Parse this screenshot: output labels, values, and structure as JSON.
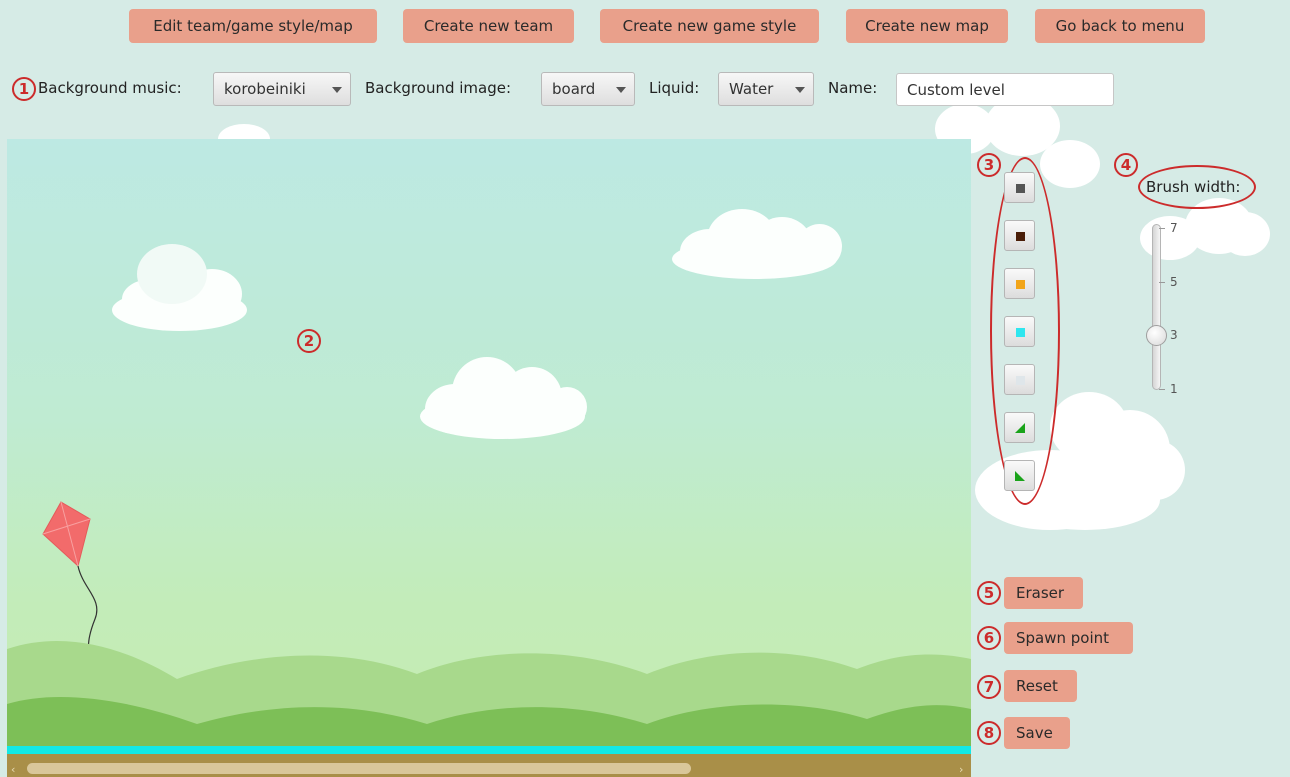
{
  "nav": {
    "edit": "Edit team/game style/map",
    "new_team": "Create new team",
    "new_style": "Create new game style",
    "new_map": "Create new map",
    "back": "Go back to menu"
  },
  "settings": {
    "music_label": "Background music:",
    "music_value": "korobeiniki",
    "image_label": "Background image:",
    "image_value": "board",
    "liquid_label": "Liquid:",
    "liquid_value": "Water",
    "name_label": "Name:",
    "name_value": "Custom level"
  },
  "brush": {
    "label": "Brush width:",
    "ticks": [
      "7",
      "5",
      "3",
      "1"
    ],
    "value": 3,
    "min": 1,
    "max": 7
  },
  "tools": [
    {
      "name": "dark-gray-block",
      "color": "#555555",
      "shape": "square"
    },
    {
      "name": "brown-block",
      "color": "#4a1d08",
      "shape": "square"
    },
    {
      "name": "orange-block",
      "color": "#f2a51a",
      "shape": "square"
    },
    {
      "name": "cyan-block",
      "color": "#2fe6ef",
      "shape": "square"
    },
    {
      "name": "ice-block",
      "color": "#dfe6ea",
      "shape": "square"
    },
    {
      "name": "green-slope-right",
      "color": "#1aa31a",
      "shape": "triangle-ne"
    },
    {
      "name": "green-slope-left",
      "color": "#1aa31a",
      "shape": "triangle-nw"
    }
  ],
  "actions": {
    "eraser": "Eraser",
    "spawn": "Spawn point",
    "reset": "Reset",
    "save": "Save"
  },
  "annotations": [
    "1",
    "2",
    "3",
    "4",
    "5",
    "6",
    "7",
    "8"
  ],
  "colors": {
    "accent_button": "#e9a08b",
    "annotation_red": "#cc2b2b",
    "water": "#12e9e6",
    "dirt": "#a98f48"
  }
}
